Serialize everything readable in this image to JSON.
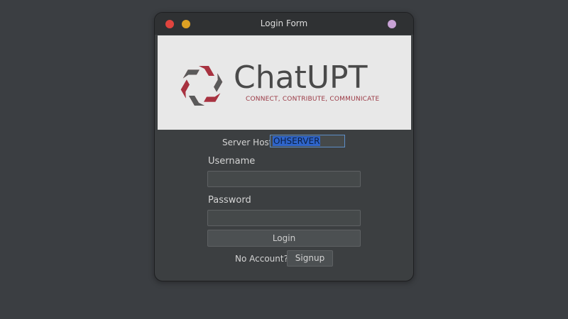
{
  "window": {
    "title": "Login Form",
    "controls": [
      {
        "name": "close",
        "color": "#e0443e"
      },
      {
        "name": "minimize",
        "color": "#dea123"
      },
      {
        "name": "maximize",
        "color": "#c8a2d6"
      }
    ]
  },
  "banner": {
    "brand": "ChatUPT",
    "tagline": "CONNECT, CONTRIBUTE, COMMUNICATE",
    "logo_icon": "hexagon-swirl-logo-icon",
    "colors": {
      "dark": "#5a5a5a",
      "accent": "#a83240"
    }
  },
  "form": {
    "server_host_label": "Server Host",
    "server_host_value": "OHSERVER",
    "username_label": "Username",
    "username_value": "",
    "password_label": "Password",
    "password_value": "",
    "login_label": "Login",
    "no_account_label": "No Account?",
    "signup_label": "Signup"
  }
}
